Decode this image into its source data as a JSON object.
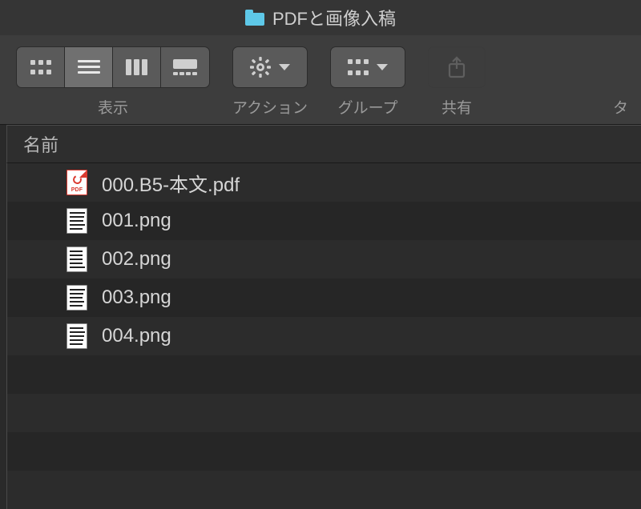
{
  "window": {
    "title": "PDFと画像入稿"
  },
  "toolbar": {
    "view_label": "表示",
    "action_label": "アクション",
    "group_label": "グループ",
    "share_label": "共有",
    "tag_label": "タ"
  },
  "header": {
    "name_col": "名前"
  },
  "files": [
    {
      "name": "000.B5-本文.pdf",
      "type": "pdf"
    },
    {
      "name": "001.png",
      "type": "img"
    },
    {
      "name": "002.png",
      "type": "img"
    },
    {
      "name": "003.png",
      "type": "img"
    },
    {
      "name": "004.png",
      "type": "img"
    }
  ]
}
